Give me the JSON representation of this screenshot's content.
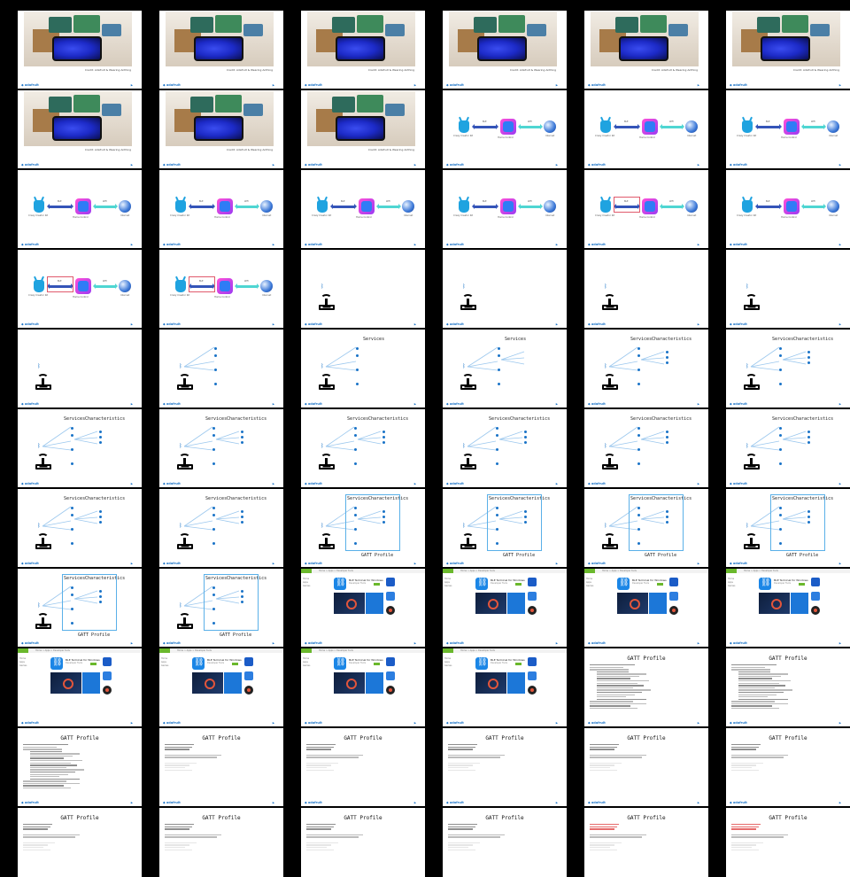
{
  "grid": {
    "columns": 6,
    "rows": 11
  },
  "photo_caption": "Credit: Adafruit & Wearing Anthing",
  "footer_logo": "adafruit",
  "arch": {
    "robot_label": "Crazy Creator Kit",
    "app_label": "Home Control",
    "globe_label": "Internet",
    "link1": "BLE",
    "link2": "WiFi"
  },
  "ble": {
    "services_label": "Services",
    "characteristics_label": "Characteristics",
    "profile_label": "GATT Profile",
    "bluetooth_icon": "bluetooth-icon"
  },
  "store": {
    "title": "BLE Terminal for Windows",
    "subtitle": "Developer Tools",
    "crumbs": "Home > Apps > Developer tools",
    "side": [
      "Home",
      "Apps",
      "Games"
    ]
  },
  "gatt": {
    "title": "GATT Profile"
  },
  "thumbs": [
    "photo",
    "photo",
    "photo",
    "photo",
    "photo",
    "photo",
    "photo",
    "photo",
    "photo",
    "arch",
    "arch",
    "arch",
    "arch",
    "arch",
    "arch",
    "arch",
    "arch-hl",
    "arch",
    "arch-hl",
    "arch-hl",
    "beacon",
    "beacon",
    "beacon",
    "beacon",
    "beacon",
    "fan",
    "services",
    "services-fan",
    "chars",
    "chars",
    "chars",
    "chars",
    "chars",
    "chars",
    "chars",
    "chars",
    "chars",
    "chars",
    "box",
    "box",
    "box",
    "box",
    "box",
    "box",
    "store",
    "store",
    "store",
    "store",
    "store",
    "store",
    "store",
    "store",
    "gatt-code",
    "gatt-code",
    "gatt-code",
    "gatt-light",
    "gatt-light",
    "gatt-light",
    "gatt-light",
    "gatt-light",
    "gatt-light",
    "gatt-light",
    "gatt-light",
    "gatt-light",
    "gatt-red",
    "gatt-red"
  ]
}
